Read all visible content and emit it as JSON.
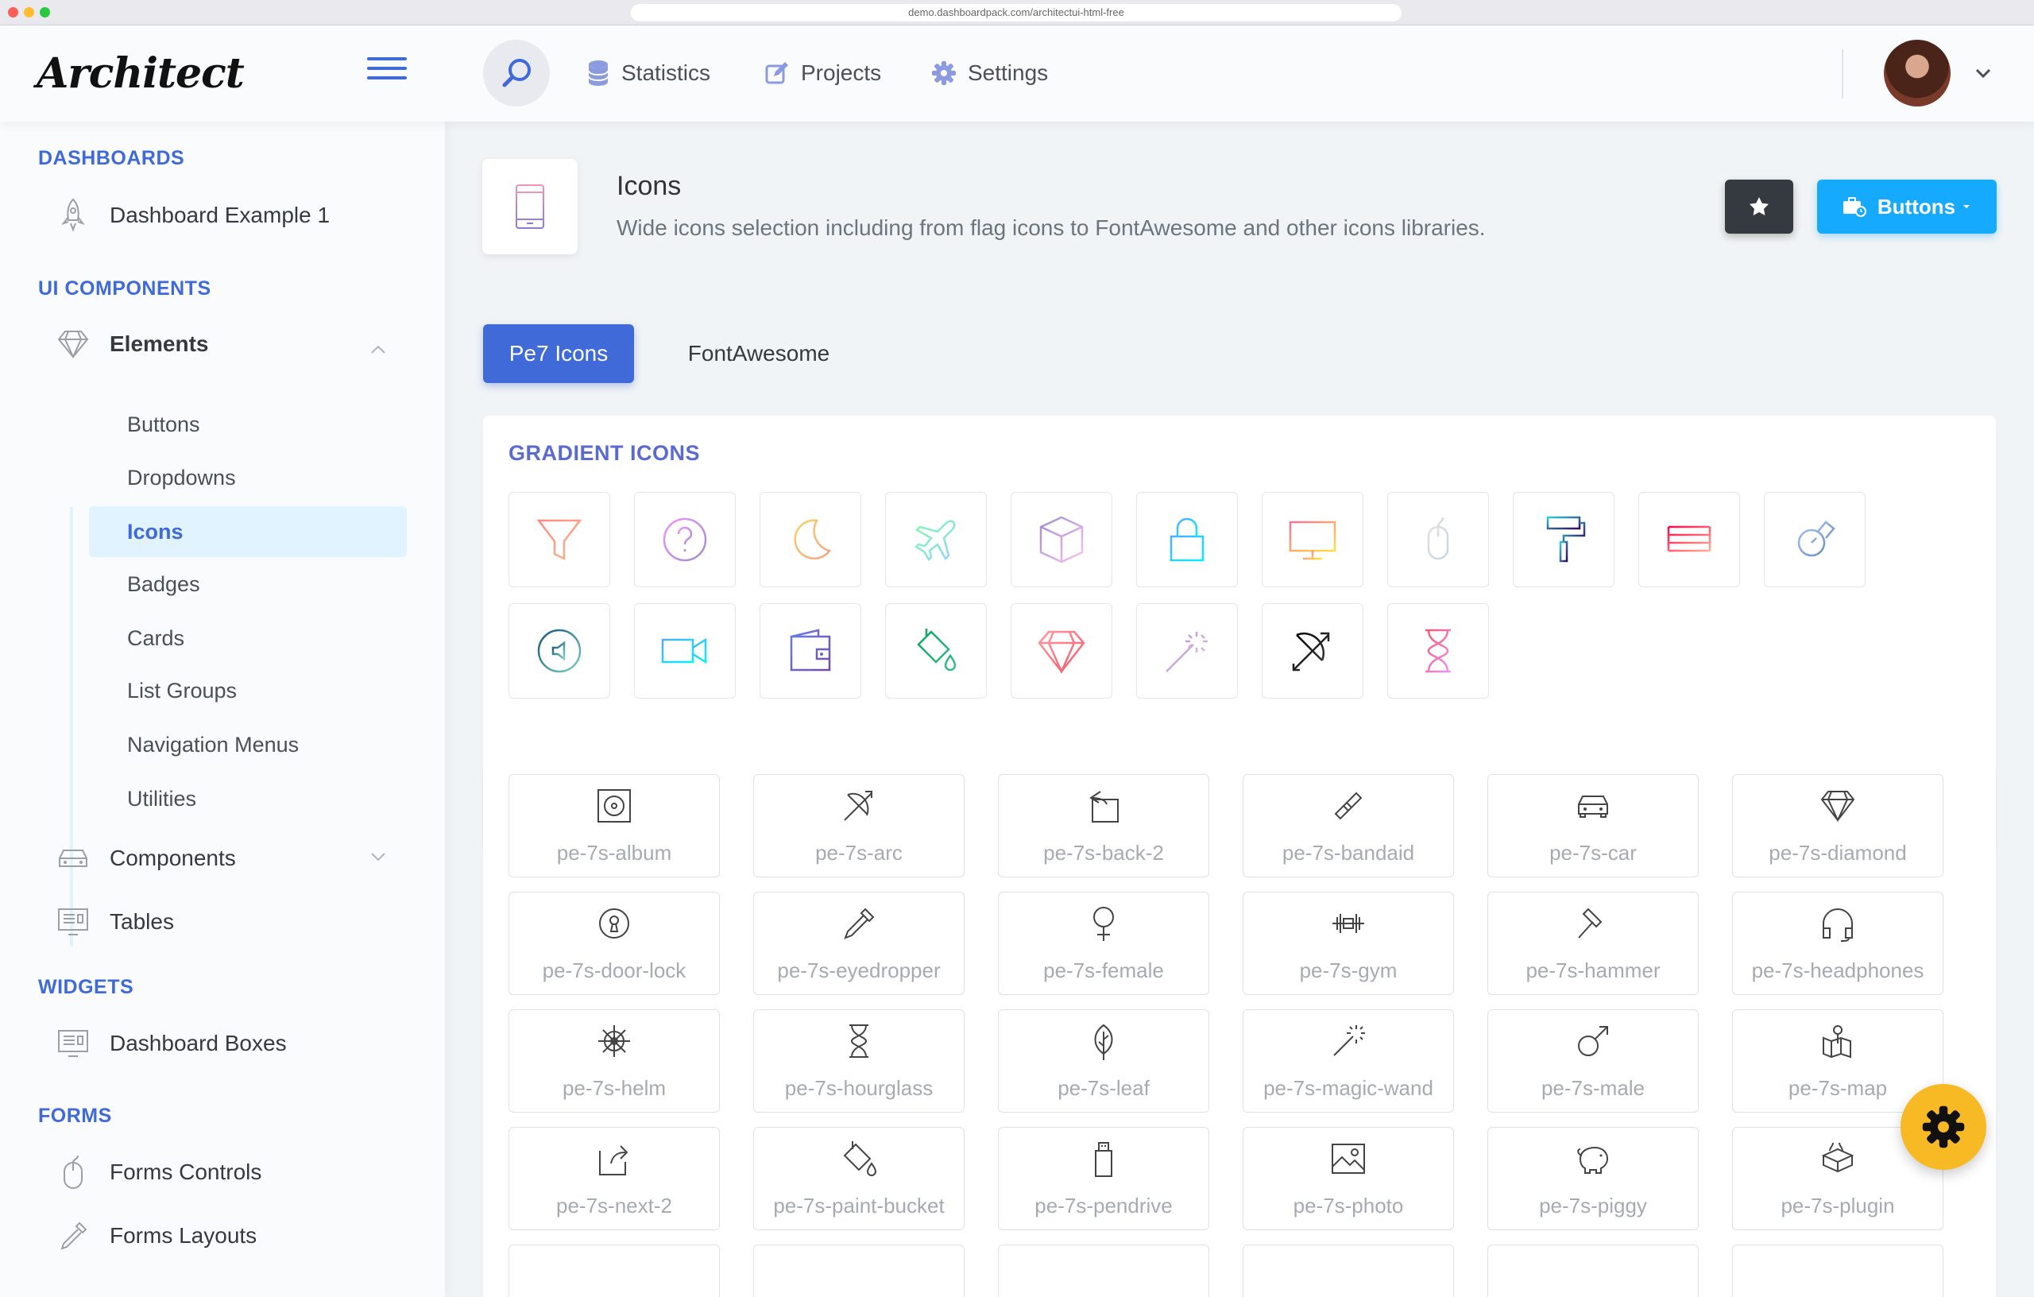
{
  "browser": {
    "url": "demo.dashboardpack.com/architectui-html-free"
  },
  "header": {
    "logo": "Architect",
    "nav": [
      {
        "label": "Statistics",
        "icon": "database-icon"
      },
      {
        "label": "Projects",
        "icon": "edit-icon"
      },
      {
        "label": "Settings",
        "icon": "gear-icon"
      }
    ]
  },
  "sidebar": {
    "sections": {
      "dashboards": "DASHBOARDS",
      "ui_components": "UI COMPONENTS",
      "widgets": "WIDGETS",
      "forms": "FORMS"
    },
    "items": {
      "dashboard_example": "Dashboard Example 1",
      "elements": "Elements",
      "components": "Components",
      "tables": "Tables",
      "dashboard_boxes": "Dashboard Boxes",
      "forms_controls": "Forms Controls",
      "forms_layouts": "Forms Layouts"
    },
    "sub_items": [
      "Buttons",
      "Dropdowns",
      "Icons",
      "Badges",
      "Cards",
      "List Groups",
      "Navigation Menus",
      "Utilities"
    ],
    "active_sub": "Icons"
  },
  "page": {
    "title": "Icons",
    "subtitle": "Wide icons selection including from flag icons to FontAwesome and other icons libraries.",
    "buttons_label": "Buttons"
  },
  "tabs": [
    "Pe7 Icons",
    "FontAwesome"
  ],
  "gradient_card": {
    "title": "GRADIENT ICONS"
  },
  "icon_list": [
    "pe-7s-album",
    "pe-7s-arc",
    "pe-7s-back-2",
    "pe-7s-bandaid",
    "pe-7s-car",
    "pe-7s-diamond",
    "pe-7s-door-lock",
    "pe-7s-eyedropper",
    "pe-7s-female",
    "pe-7s-gym",
    "pe-7s-hammer",
    "pe-7s-headphones",
    "pe-7s-helm",
    "pe-7s-hourglass",
    "pe-7s-leaf",
    "pe-7s-magic-wand",
    "pe-7s-male",
    "pe-7s-map",
    "pe-7s-next-2",
    "pe-7s-paint-bucket",
    "pe-7s-pendrive",
    "pe-7s-photo",
    "pe-7s-piggy",
    "pe-7s-plugin"
  ],
  "colors": {
    "primary": "#3f6ad8",
    "info": "#16aaff",
    "dark": "#343a40",
    "warning": "#f7b924"
  }
}
